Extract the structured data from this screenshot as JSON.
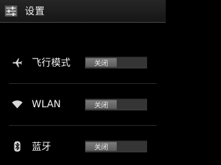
{
  "actionbar": {
    "title": "设置",
    "icon": "settings-sliders-icon"
  },
  "settings": {
    "items": [
      {
        "icon": "airplane-icon",
        "label": "飞行模式",
        "toggle_text": "关闭",
        "enabled": false
      },
      {
        "icon": "wifi-icon",
        "label": "WLAN",
        "toggle_text": "关闭",
        "enabled": false
      },
      {
        "icon": "bluetooth-icon",
        "label": "蓝牙",
        "toggle_text": "关闭",
        "enabled": false
      }
    ]
  },
  "colors": {
    "background": "#000000",
    "actionbar": "#1e1e1e",
    "toggle_track": "#353535",
    "toggle_thumb": "#6c6c6c"
  }
}
